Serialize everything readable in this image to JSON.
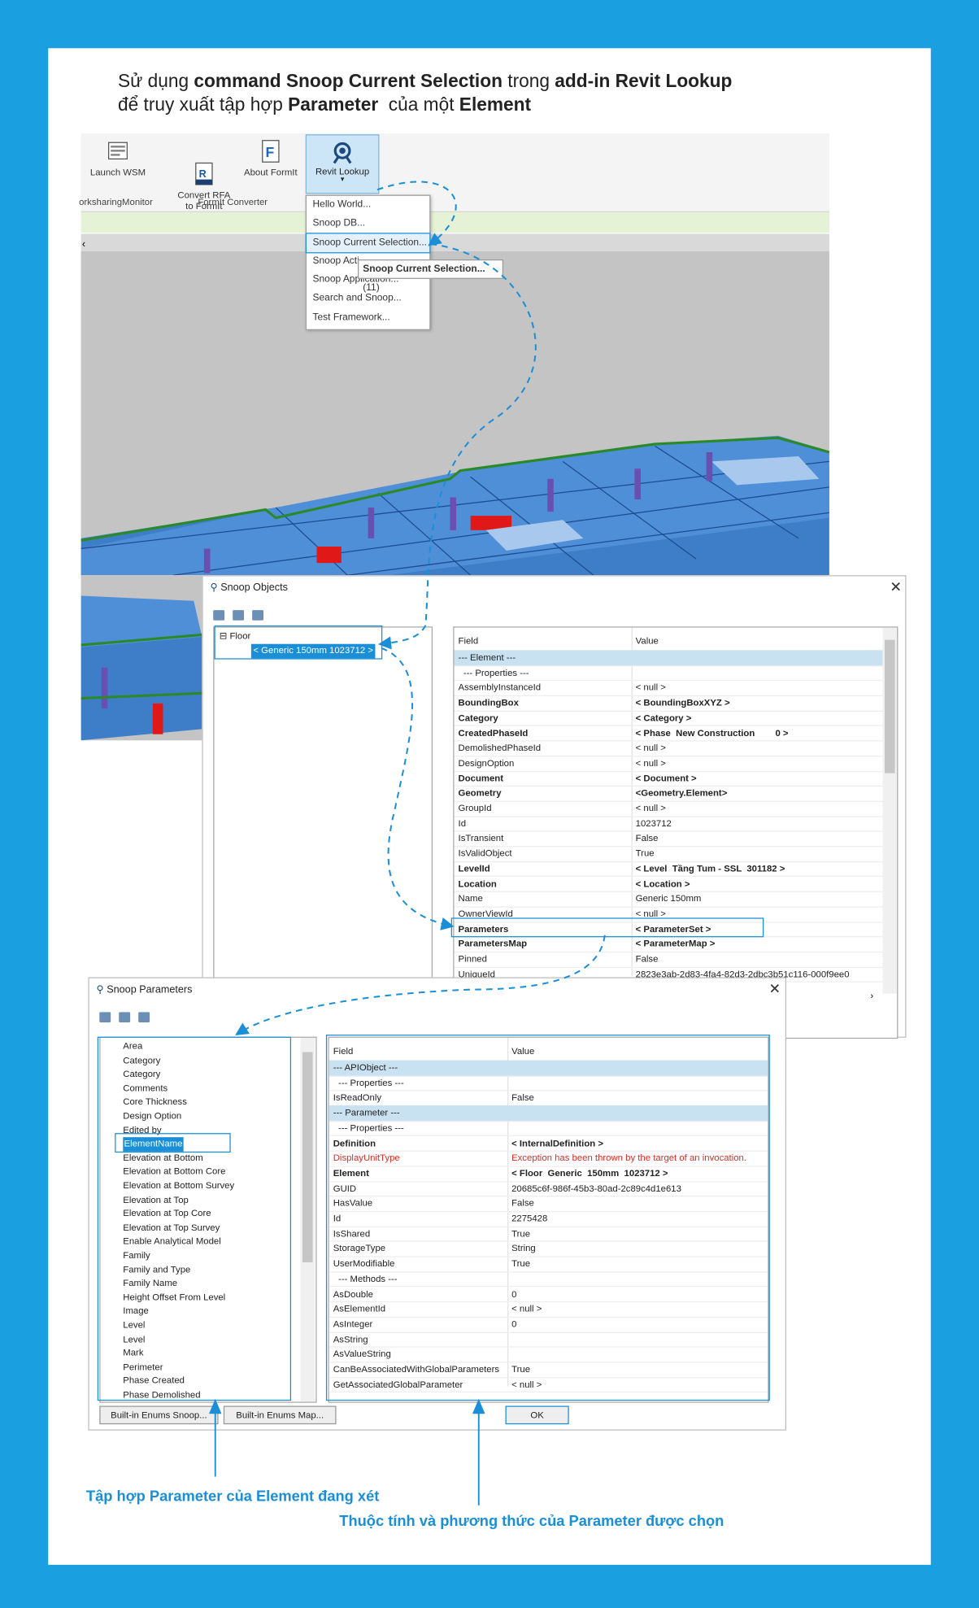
{
  "heading": {
    "line1": [
      {
        "t": "Sử dụng ",
        "b": false
      },
      {
        "t": "command Snoop Current Selection",
        "b": true
      },
      {
        "t": " trong ",
        "b": false
      },
      {
        "t": "add-in Revit Lookup",
        "b": true
      }
    ],
    "line2": [
      {
        "t": "để truy xuất tập hợp ",
        "b": false
      },
      {
        "t": "Parameter",
        "b": true
      },
      {
        "t": "  của một ",
        "b": false
      },
      {
        "t": "Element",
        "b": true
      }
    ]
  },
  "ribbon": {
    "launch_wsm": "Launch WSM",
    "convert_rfa": "Convert RFA\nto FormIt",
    "about_formit": "About FormIt",
    "revit_lookup": "Revit Lookup",
    "group_worksharing": "orksharingMonitor",
    "group_formit": "FormIt Converter"
  },
  "menu": {
    "items": [
      "Hello World...",
      "Snoop DB...",
      "Snoop Current Selection...",
      "Snoop Acti",
      "Snoop Application...",
      "Search and Snoop...",
      "Test Framework..."
    ],
    "tooltip_title": "Snoop Current Selection...",
    "tooltip_shortcut": " (11)"
  },
  "tab_close": "‹",
  "snoop_objects": {
    "title": "Snoop Objects",
    "close": "✕",
    "tree_root": "Floor",
    "tree_child": "< Generic 150mm  1023712 >",
    "col_field": "Field",
    "col_value": "Value",
    "rows": [
      {
        "f": "--- Element ---",
        "v": "",
        "band": true
      },
      {
        "f": "  --- Properties ---",
        "v": ""
      },
      {
        "f": "AssemblyInstanceId",
        "v": "< null >"
      },
      {
        "f": "BoundingBox",
        "v": "< BoundingBoxXYZ >",
        "bold": true
      },
      {
        "f": "Category",
        "v": "< Category >",
        "bold": true
      },
      {
        "f": "CreatedPhaseId",
        "v": "< Phase  New Construction        0 >",
        "bold": true
      },
      {
        "f": "DemolishedPhaseId",
        "v": "< null >"
      },
      {
        "f": "DesignOption",
        "v": "< null >"
      },
      {
        "f": "Document",
        "v": "< Document >",
        "bold": true
      },
      {
        "f": "Geometry",
        "v": "<Geometry.Element>",
        "bold": true
      },
      {
        "f": "GroupId",
        "v": "< null >"
      },
      {
        "f": "Id",
        "v": "1023712"
      },
      {
        "f": "IsTransient",
        "v": "False"
      },
      {
        "f": "IsValidObject",
        "v": "True"
      },
      {
        "f": "LevelId",
        "v": "< Level  Tầng Tum - SSL  301182 >",
        "bold": true
      },
      {
        "f": "Location",
        "v": "< Location >",
        "bold": true
      },
      {
        "f": "Name",
        "v": "Generic 150mm"
      },
      {
        "f": "OwnerViewId",
        "v": "< null >"
      },
      {
        "f": "Parameters",
        "v": "< ParameterSet >",
        "bold": true
      },
      {
        "f": "ParametersMap",
        "v": "< ParameterMap >",
        "bold": true
      },
      {
        "f": "Pinned",
        "v": "False"
      },
      {
        "f": "UniqueId",
        "v": "2823e3ab-2d83-4fa4-82d3-2dbc3b51c116-000f9ee0"
      }
    ]
  },
  "snoop_parameters": {
    "title": "Snoop Parameters",
    "close": "✕",
    "params": [
      "Area",
      "Category",
      "Category",
      "Comments",
      "Core Thickness",
      "Design Option",
      "Edited by",
      "ElementName",
      "Elevation at Bottom",
      "Elevation at Bottom Core",
      "Elevation at Bottom Survey",
      "Elevation at Top",
      "Elevation at Top Core",
      "Elevation at Top Survey",
      "Enable Analytical Model",
      "Family",
      "Family and Type",
      "Family Name",
      "Height Offset From Level",
      "Image",
      "Level",
      "Level",
      "Mark",
      "Perimeter",
      "Phase Created",
      "Phase Demolished"
    ],
    "col_field": "Field",
    "col_value": "Value",
    "rows": [
      {
        "f": "--- APIObject ---",
        "v": "",
        "band": true
      },
      {
        "f": "  --- Properties ---",
        "v": ""
      },
      {
        "f": "IsReadOnly",
        "v": "False"
      },
      {
        "f": "--- Parameter ---",
        "v": "",
        "band": true
      },
      {
        "f": "  --- Properties ---",
        "v": ""
      },
      {
        "f": "Definition",
        "v": "< InternalDefinition >",
        "bold": true
      },
      {
        "f": "DisplayUnitType",
        "v": "Exception has been thrown by the target of an invocation.",
        "red": true
      },
      {
        "f": "Element",
        "v": "< Floor  Generic  150mm  1023712 >",
        "bold": true
      },
      {
        "f": "GUID",
        "v": "20685c6f-986f-45b3-80ad-2c89c4d1e613"
      },
      {
        "f": "HasValue",
        "v": "False"
      },
      {
        "f": "Id",
        "v": "2275428"
      },
      {
        "f": "IsShared",
        "v": "True"
      },
      {
        "f": "StorageType",
        "v": "String"
      },
      {
        "f": "UserModifiable",
        "v": "True"
      },
      {
        "f": "  --- Methods ---",
        "v": ""
      },
      {
        "f": "AsDouble",
        "v": "0"
      },
      {
        "f": "AsElementId",
        "v": "< null >"
      },
      {
        "f": "AsInteger",
        "v": "0"
      },
      {
        "f": "AsString",
        "v": ""
      },
      {
        "f": "AsValueString",
        "v": ""
      },
      {
        "f": "CanBeAssociatedWithGlobalParameters",
        "v": "True"
      },
      {
        "f": "GetAssociatedGlobalParameter",
        "v": "< null >"
      }
    ],
    "btn_enums_snoop": "Built-in Enums Snoop...",
    "btn_enums_map": "Built-in Enums Map...",
    "btn_ok": "OK"
  },
  "captions": {
    "left": "Tập hợp Parameter của Element đang xét",
    "right": "Thuộc tính và phương thức của Parameter được chọn"
  },
  "colors": {
    "accent": "#1a8fd8",
    "border": "#1aa0e0",
    "band": "#c9e2f2",
    "beam": "#2f63b0",
    "red": "#e01818"
  }
}
